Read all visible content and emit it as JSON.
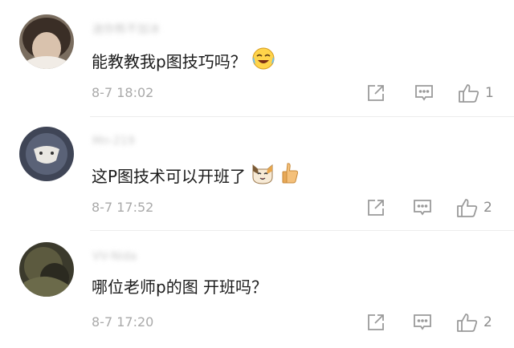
{
  "comments": [
    {
      "username": "迷你熊不加冰",
      "text": "能教教我p图技巧吗？",
      "emoji": "laughing-crying-emoji",
      "timestamp": "8-7 18:02",
      "likes": "1"
    },
    {
      "username": "Mn-219",
      "text": "这P图技术可以开班了",
      "emoji": "cat-face-and-thumbs-up-emoji",
      "timestamp": "8-7 17:52",
      "likes": "2"
    },
    {
      "username": "VV-Nida",
      "text": "哪位老师p的图 开班吗？",
      "emoji": "",
      "timestamp": "8-7 17:20",
      "likes": "2"
    }
  ],
  "icons": {
    "share": "share-icon",
    "reply": "comment-icon",
    "like": "thumbs-up-icon"
  },
  "colors": {
    "text": "#1b1b1b",
    "meta": "#a9a9a9",
    "icon": "#9a9a9a",
    "divider": "#ececec"
  }
}
